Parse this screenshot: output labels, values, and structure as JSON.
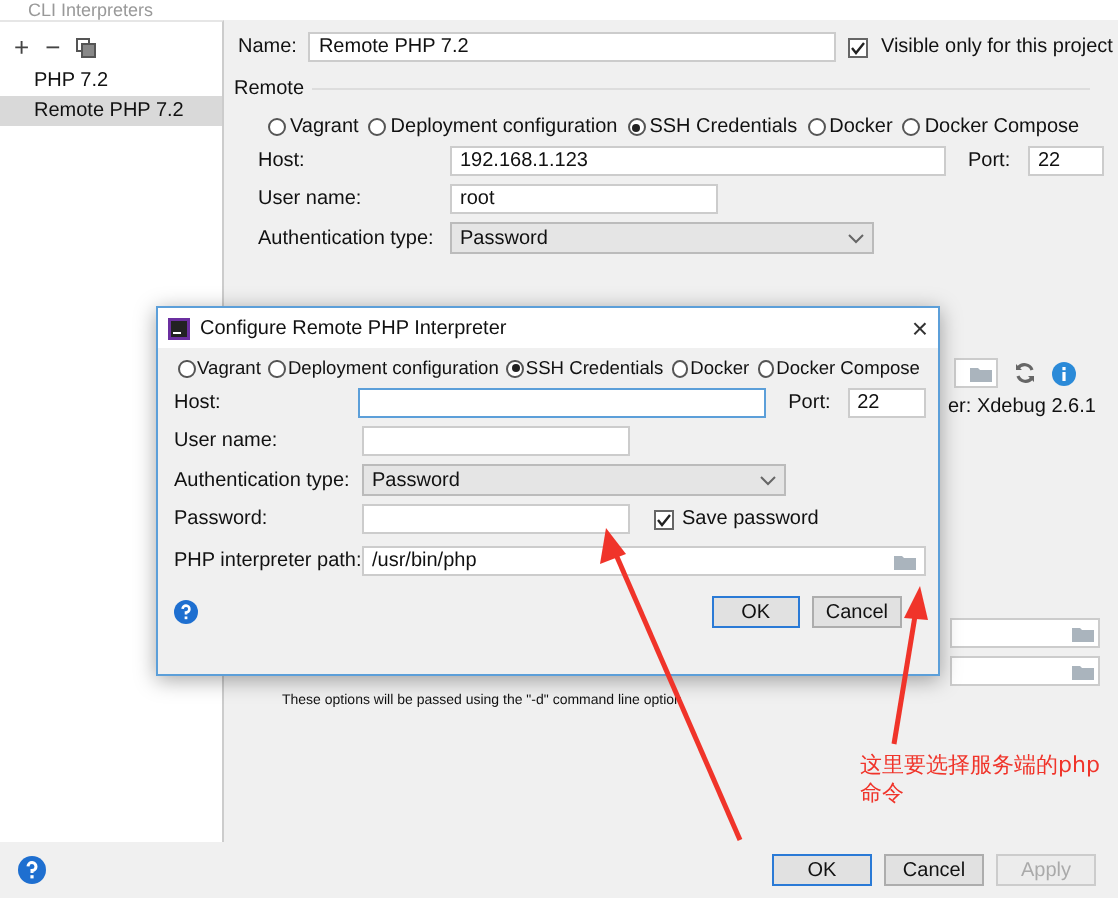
{
  "window": {
    "title": "CLI Interpreters"
  },
  "sidebar": {
    "toolbar": [
      "+",
      "−"
    ],
    "items": [
      {
        "label": "PHP 7.2",
        "selected": false
      },
      {
        "label": "Remote PHP 7.2",
        "selected": true
      }
    ]
  },
  "name": {
    "label": "Name:",
    "value": "Remote PHP 7.2"
  },
  "visible_only": {
    "label": "Visible only for this project",
    "checked": true
  },
  "remote": {
    "heading": "Remote",
    "options": [
      {
        "label": "Vagrant",
        "selected": false
      },
      {
        "label": "Deployment configuration",
        "selected": false
      },
      {
        "label": "SSH Credentials",
        "selected": true
      },
      {
        "label": "Docker",
        "selected": false
      },
      {
        "label": "Docker Compose",
        "selected": false
      }
    ],
    "host": {
      "label": "Host:",
      "value": "192.168.1.123"
    },
    "port": {
      "label": "Port:",
      "value": "22"
    },
    "user": {
      "label": "User name:",
      "value": "root"
    },
    "auth": {
      "label": "Authentication type:",
      "value": "Password"
    }
  },
  "debugger_partial": "er: Xdebug 2.6.1",
  "options_note": "These options will be passed using the \"-d\" command line option",
  "buttons": [
    {
      "label": "OK",
      "disabled": false
    },
    {
      "label": "Cancel",
      "disabled": false
    },
    {
      "label": "Apply",
      "disabled": true
    }
  ],
  "dialog": {
    "title": "Configure Remote PHP Interpreter",
    "close": "×",
    "options": [
      {
        "label": "Vagrant",
        "selected": false
      },
      {
        "label": "Deployment configuration",
        "selected": false
      },
      {
        "label": "SSH Credentials",
        "selected": true
      },
      {
        "label": "Docker",
        "selected": false
      },
      {
        "label": "Docker Compose",
        "selected": false
      }
    ],
    "host": {
      "label": "Host:"
    },
    "port": {
      "label": "Port:",
      "value": "22"
    },
    "user": {
      "label": "User name:"
    },
    "auth": {
      "label": "Authentication type:",
      "value": "Password"
    },
    "password": {
      "label": "Password:"
    },
    "save_password": {
      "label": "Save password",
      "checked": true
    },
    "path": {
      "label": "PHP interpreter path:",
      "value": "/usr/bin/php"
    },
    "buttons": [
      {
        "label": "OK",
        "disabled": false
      },
      {
        "label": "Cancel",
        "disabled": false
      }
    ]
  },
  "annotation": {
    "text": "这里要选择服务端的php命令"
  }
}
